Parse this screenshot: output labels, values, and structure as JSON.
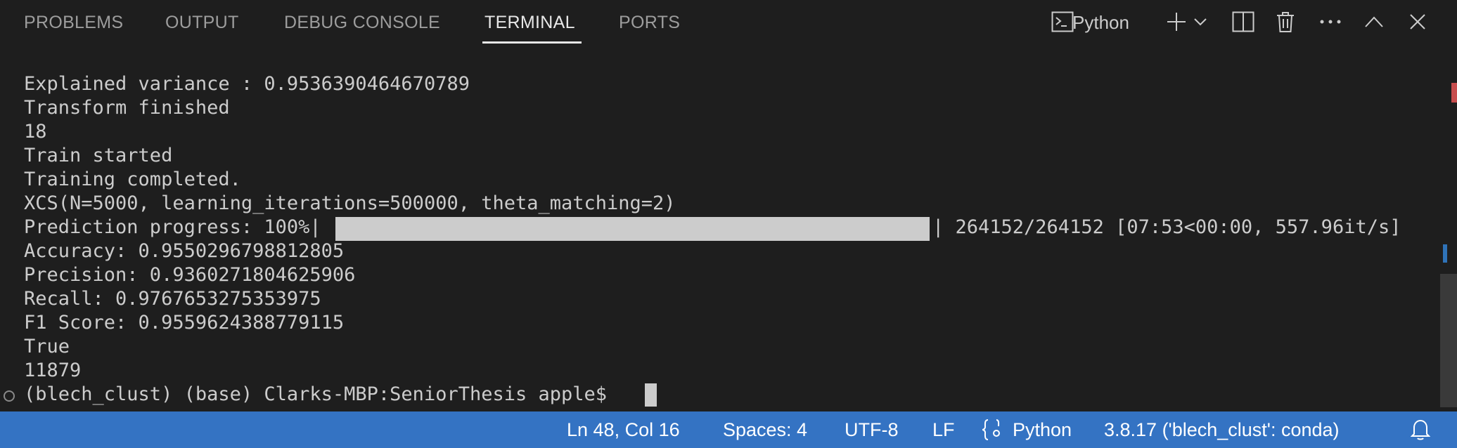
{
  "panel": {
    "tabs": [
      {
        "label": "PROBLEMS"
      },
      {
        "label": "OUTPUT"
      },
      {
        "label": "DEBUG CONSOLE"
      },
      {
        "label": "TERMINAL"
      },
      {
        "label": "PORTS"
      }
    ],
    "active_tab": "TERMINAL",
    "terminal_profile": "Python",
    "actions": [
      "terminal-icon",
      "plus-icon",
      "chevron-down-icon",
      "split-editor-icon",
      "trash-icon",
      "ellipsis-icon",
      "chevron-up-icon",
      "close-icon"
    ]
  },
  "terminal": {
    "lines": [
      "Explained variance : 0.9536390464670789",
      "Transform finished",
      "18",
      "Train started",
      "Training completed.",
      "XCS(N=5000, learning_iterations=500000, theta_matching=2)",
      "Prediction progress: 100%|",
      "Accuracy: 0.9550296798812805",
      "Precision: 0.9360271804625906",
      "Recall: 0.9767653275353975",
      "F1 Score: 0.9559624388779115",
      "True",
      "11879",
      "(blech_clust) (base) Clarks-MBP:SeniorThesis apple$ "
    ],
    "progress_suffix": "| 264152/264152 [07:53<00:00, 557.96it/s]",
    "progress_fraction": 1.0
  },
  "status_bar": {
    "position": "Ln 48, Col 16",
    "indentation": "Spaces: 4",
    "encoding": "UTF-8",
    "eol": "LF",
    "language": "Python",
    "interpreter": "3.8.17 ('blech_clust': conda)"
  },
  "colors": {
    "background": "#1e1e1e",
    "status_bar": "#3473c3",
    "text": "#cccccc",
    "progress_bar": "#cccccc"
  }
}
